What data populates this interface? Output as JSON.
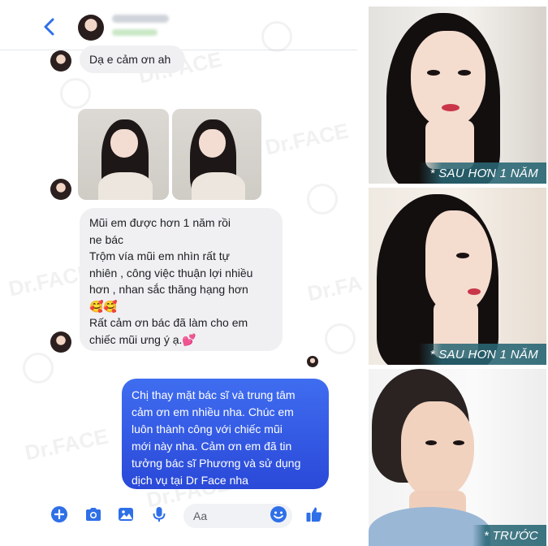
{
  "chat": {
    "messages": {
      "first": "Dạ e cảm ơn ah",
      "second_lines": [
        "Mũi em được hơn 1 năm rồi",
        "ne bác",
        "Trộm vía mũi em nhìn rất tự",
        "nhiên , công việc thuận lợi nhiều",
        "hơn , nhan sắc thăng hạng hơn",
        "🥰🥰",
        "Rất cảm ơn bác đã làm cho em",
        "chiếc mũi ưng ý ạ.💕"
      ],
      "reply_lines": [
        "Chị thay mặt bác sĩ và trung tâm",
        "cảm ơn em nhiều nha. Chúc em",
        "luôn thành công với chiếc mũi",
        "mới này nha. Cảm ơn em đã tin",
        "tưởng bác sĩ Phương và sử dụng",
        "dịch vụ tại Dr Face nha"
      ]
    },
    "composer": {
      "placeholder": "Aa"
    },
    "icons": {
      "back": "chevron-left-icon",
      "plus": "plus-circle-icon",
      "camera": "camera-icon",
      "gallery": "image-icon",
      "mic": "microphone-icon",
      "emoji": "smiley-icon",
      "like": "thumbs-up-icon"
    },
    "colors": {
      "accent": "#2f6fe8",
      "outgoing_bubble": "#3352e3",
      "incoming_bubble": "#f0f0f3"
    }
  },
  "panel": {
    "captions": {
      "after_1": "* SAU HƠN 1 NĂM",
      "after_2": "* SAU HƠN 1 NĂM",
      "before": "* TRƯỚC"
    },
    "caption_color": "#2b6f7d"
  },
  "watermark": "Dr.FACE"
}
